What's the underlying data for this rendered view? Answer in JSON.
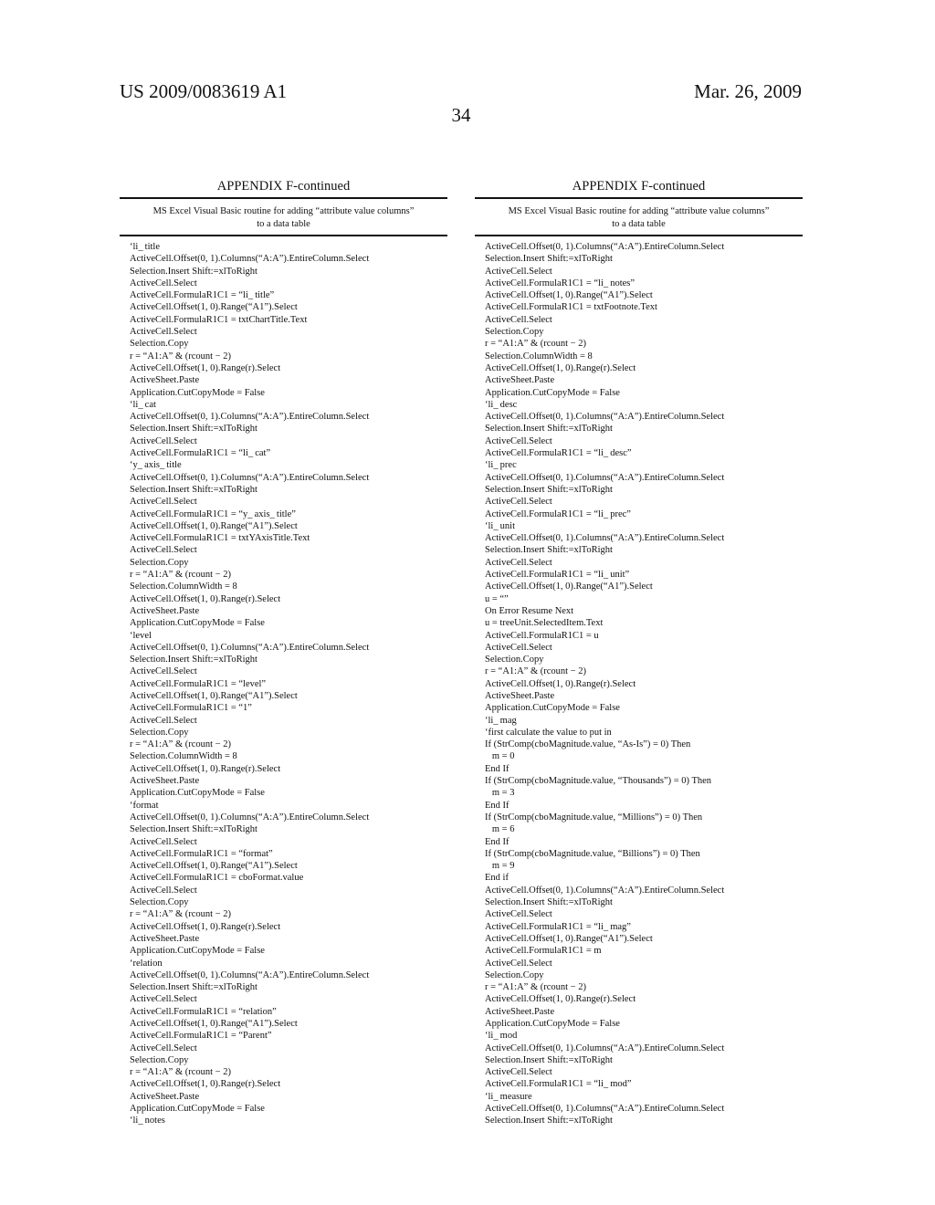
{
  "header": {
    "patent_number": "US 2009/0083619 A1",
    "date": "Mar. 26, 2009",
    "page_number": "34"
  },
  "columns": [
    {
      "appendix_title": "APPENDIX F-continued",
      "table_caption_line1": "MS Excel Visual Basic routine for adding “attribute value columns”",
      "table_caption_line2": "to a data table",
      "lines": [
        "‘li_ title",
        "ActiveCell.Offset(0, 1).Columns(“A:A”).EntireColumn.Select",
        "Selection.Insert Shift:=xlToRight",
        "ActiveCell.Select",
        "ActiveCell.FormulaR1C1 = “li_ title”",
        "ActiveCell.Offset(1, 0).Range(“A1”).Select",
        "ActiveCell.FormulaR1C1 = txtChartTitle.Text",
        "ActiveCell.Select",
        "Selection.Copy",
        "r = “A1:A” & (rcount − 2)",
        "ActiveCell.Offset(1, 0).Range(r).Select",
        "ActiveSheet.Paste",
        "Application.CutCopyMode = False",
        "‘li_ cat",
        "ActiveCell.Offset(0, 1).Columns(“A:A”).EntireColumn.Select",
        "Selection.Insert Shift:=xlToRight",
        "ActiveCell.Select",
        "ActiveCell.FormulaR1C1 = “li_ cat”",
        "‘y_ axis_ title",
        "ActiveCell.Offset(0, 1).Columns(“A:A”).EntireColumn.Select",
        "Selection.Insert Shift:=xlToRight",
        "ActiveCell.Select",
        "ActiveCell.FormulaR1C1 = “y_ axis_ title”",
        "ActiveCell.Offset(1, 0).Range(“A1”).Select",
        "ActiveCell.FormulaR1C1 = txtYAxisTitle.Text",
        "ActiveCell.Select",
        "Selection.Copy",
        "r = “A1:A” & (rcount − 2)",
        "Selection.ColumnWidth = 8",
        "ActiveCell.Offset(1, 0).Range(r).Select",
        "ActiveSheet.Paste",
        "Application.CutCopyMode = False",
        "‘level",
        "ActiveCell.Offset(0, 1).Columns(“A:A”).EntireColumn.Select",
        "Selection.Insert Shift:=xlToRight",
        "ActiveCell.Select",
        "ActiveCell.FormulaR1C1 = “level”",
        "ActiveCell.Offset(1, 0).Range(“A1”).Select",
        "ActiveCell.FormulaR1C1 = “1”",
        "ActiveCell.Select",
        "Selection.Copy",
        "r = “A1:A” & (rcount − 2)",
        "Selection.ColumnWidth = 8",
        "ActiveCell.Offset(1, 0).Range(r).Select",
        "ActiveSheet.Paste",
        "Application.CutCopyMode = False",
        "‘format",
        "ActiveCell.Offset(0, 1).Columns(“A:A”).EntireColumn.Select",
        "Selection.Insert Shift:=xlToRight",
        "ActiveCell.Select",
        "ActiveCell.FormulaR1C1 = “format”",
        "ActiveCell.Offset(1, 0).Range(“A1”).Select",
        "ActiveCell.FormulaR1C1 = cboFormat.value",
        "ActiveCell.Select",
        "Selection.Copy",
        "r = “A1:A” & (rcount − 2)",
        "ActiveCell.Offset(1, 0).Range(r).Select",
        "ActiveSheet.Paste",
        "Application.CutCopyMode = False",
        "‘relation",
        "ActiveCell.Offset(0, 1).Columns(“A:A”).EntireColumn.Select",
        "Selection.Insert Shift:=xlToRight",
        "ActiveCell.Select",
        "ActiveCell.FormulaR1C1 = “relation”",
        "ActiveCell.Offset(1, 0).Range(“A1”).Select",
        "ActiveCell.FormulaR1C1 = “Parent”",
        "ActiveCell.Select",
        "Selection.Copy",
        "r = “A1:A” & (rcount − 2)",
        "ActiveCell.Offset(1, 0).Range(r).Select",
        "ActiveSheet.Paste",
        "Application.CutCopyMode = False",
        "‘li_ notes"
      ]
    },
    {
      "appendix_title": "APPENDIX F-continued",
      "table_caption_line1": "MS Excel Visual Basic routine for adding “attribute value columns”",
      "table_caption_line2": "to a data table",
      "lines": [
        "ActiveCell.Offset(0, 1).Columns(“A:A”).EntireColumn.Select",
        "Selection.Insert Shift:=xlToRight",
        "ActiveCell.Select",
        "ActiveCell.FormulaR1C1 = “li_ notes”",
        "ActiveCell.Offset(1, 0).Range(“A1”).Select",
        "ActiveCell.FormulaR1C1 = txtFootnote.Text",
        "ActiveCell.Select",
        "Selection.Copy",
        "r = “A1:A” & (rcount − 2)",
        "Selection.ColumnWidth = 8",
        "ActiveCell.Offset(1, 0).Range(r).Select",
        "ActiveSheet.Paste",
        "Application.CutCopyMode = False",
        "‘li_ desc",
        "ActiveCell.Offset(0, 1).Columns(“A:A”).EntireColumn.Select",
        "Selection.Insert Shift:=xlToRight",
        "ActiveCell.Select",
        "ActiveCell.FormulaR1C1 = “li_ desc”",
        "‘li_ prec",
        "ActiveCell.Offset(0, 1).Columns(“A:A”).EntireColumn.Select",
        "Selection.Insert Shift:=xlToRight",
        "ActiveCell.Select",
        "ActiveCell.FormulaR1C1 = “li_ prec”",
        "‘li_ unit",
        "ActiveCell.Offset(0, 1).Columns(“A:A”).EntireColumn.Select",
        "Selection.Insert Shift:=xlToRight",
        "ActiveCell.Select",
        "ActiveCell.FormulaR1C1 = “li_ unit”",
        "ActiveCell.Offset(1, 0).Range(“A1”).Select",
        "u = “”",
        "On Error Resume Next",
        "u = treeUnit.SelectedItem.Text",
        "ActiveCell.FormulaR1C1 = u",
        "ActiveCell.Select",
        "Selection.Copy",
        "r = “A1:A” & (rcount − 2)",
        "ActiveCell.Offset(1, 0).Range(r).Select",
        "ActiveSheet.Paste",
        "Application.CutCopyMode = False",
        "‘li_ mag",
        "‘first calculate the value to put in",
        "If (StrComp(cboMagnitude.value, “As-Is”) = 0) Then",
        "   m = 0",
        "End If",
        "If (StrComp(cboMagnitude.value, “Thousands”) = 0) Then",
        "   m = 3",
        "End If",
        "If (StrComp(cboMagnitude.value, “Millions”) = 0) Then",
        "   m = 6",
        "End If",
        "If (StrComp(cboMagnitude.value, “Billions”) = 0) Then",
        "   m = 9",
        "End if",
        "ActiveCell.Offset(0, 1).Columns(“A:A”).EntireColumn.Select",
        "Selection.Insert Shift:=xlToRight",
        "ActiveCell.Select",
        "ActiveCell.FormulaR1C1 = “li_ mag”",
        "ActiveCell.Offset(1, 0).Range(“A1”).Select",
        "ActiveCell.FormulaR1C1 = m",
        "ActiveCell.Select",
        "Selection.Copy",
        "r = “A1:A” & (rcount − 2)",
        "ActiveCell.Offset(1, 0).Range(r).Select",
        "ActiveSheet.Paste",
        "Application.CutCopyMode = False",
        "‘li_ mod",
        "ActiveCell.Offset(0, 1).Columns(“A:A”).EntireColumn.Select",
        "Selection.Insert Shift:=xlToRight",
        "ActiveCell.Select",
        "ActiveCell.FormulaR1C1 = “li_ mod”",
        "‘li_ measure",
        "ActiveCell.Offset(0, 1).Columns(“A:A”).EntireColumn.Select",
        "Selection.Insert Shift:=xlToRight"
      ]
    }
  ]
}
